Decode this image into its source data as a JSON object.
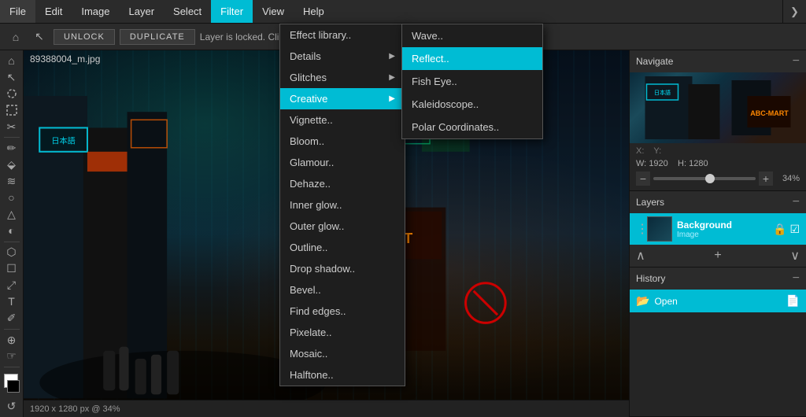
{
  "menubar": {
    "items": [
      "File",
      "Edit",
      "Image",
      "Layer",
      "Select",
      "Filter",
      "View",
      "Help"
    ]
  },
  "toolbar": {
    "unlock_label": "UNLOCK",
    "duplicate_label": "DUPLICATE",
    "layer_info": "Layer is locked. Click Unlock to enable transforms."
  },
  "canvas": {
    "filename": "89388004_m.jpg",
    "status": "1920 x 1280 px @ 34%"
  },
  "filter_menu": {
    "items": [
      {
        "label": "Effect library..",
        "has_arrow": false
      },
      {
        "label": "Details",
        "has_arrow": true
      },
      {
        "label": "Glitches",
        "has_arrow": true
      },
      {
        "label": "Creative",
        "has_arrow": true,
        "active": true
      },
      {
        "label": "Vignette..",
        "has_arrow": false
      },
      {
        "label": "Bloom..",
        "has_arrow": false
      },
      {
        "label": "Glamour..",
        "has_arrow": false
      },
      {
        "label": "Dehaze..",
        "has_arrow": false
      },
      {
        "label": "Inner glow..",
        "has_arrow": false
      },
      {
        "label": "Outer glow..",
        "has_arrow": false
      },
      {
        "label": "Outline..",
        "has_arrow": false
      },
      {
        "label": "Drop shadow..",
        "has_arrow": false
      },
      {
        "label": "Bevel..",
        "has_arrow": false
      },
      {
        "label": "Find edges..",
        "has_arrow": false
      },
      {
        "label": "Pixelate..",
        "has_arrow": false
      },
      {
        "label": "Mosaic..",
        "has_arrow": false
      },
      {
        "label": "Halftone..",
        "has_arrow": false
      }
    ]
  },
  "creative_menu": {
    "items": [
      {
        "label": "Wave..",
        "active": false
      },
      {
        "label": "Reflect..",
        "active": true
      },
      {
        "label": "Fish Eye..",
        "active": false
      },
      {
        "label": "Kaleidoscope..",
        "active": false
      },
      {
        "label": "Polar Coordinates..",
        "active": false
      }
    ]
  },
  "navigate": {
    "title": "Navigate",
    "x_label": "X:",
    "y_label": "Y:",
    "w_label": "W:",
    "w_value": "1920",
    "h_label": "H:",
    "h_value": "1280",
    "zoom": "34%",
    "minus": "−",
    "plus": "+"
  },
  "layers": {
    "title": "Layers",
    "items": [
      {
        "name": "Background",
        "type": "Image"
      }
    ]
  },
  "history": {
    "title": "History",
    "items": [
      {
        "label": "Open"
      }
    ]
  },
  "tools": {
    "icons": [
      "⌂",
      "↖",
      "⬡",
      "⬚",
      "✂",
      "⌕",
      "✐",
      "⬙",
      "◯",
      "✚",
      "⚙",
      "≋",
      "○",
      "△",
      "❏",
      "T",
      "↗",
      "⊕",
      "☞"
    ]
  }
}
